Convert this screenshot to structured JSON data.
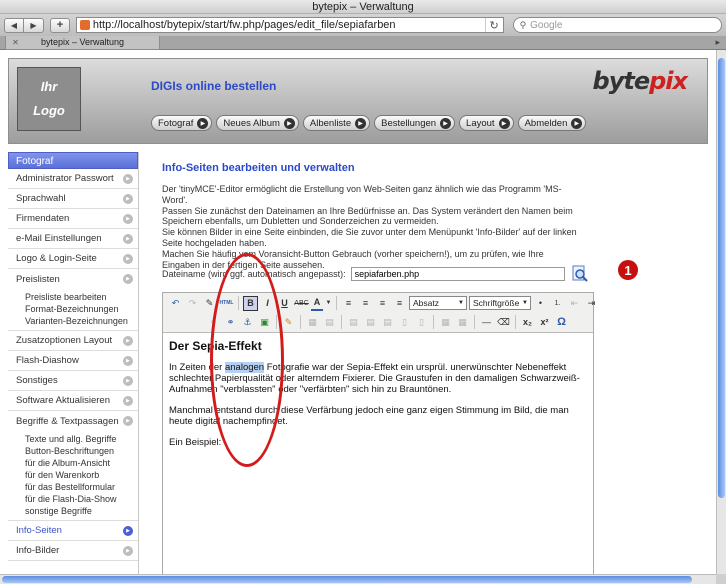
{
  "window": {
    "title": "bytepix – Verwaltung"
  },
  "browser": {
    "url": "http://localhost/bytepix/start/fw.php/pages/edit_file/sepiafarben",
    "search_placeholder": "Google",
    "tab_label": "bytepix – Verwaltung"
  },
  "header": {
    "logo_line1": "Ihr",
    "logo_line2": "Logo",
    "tagline": "DIGIs online bestellen",
    "brand_part1": "byte",
    "brand_part2": "pix",
    "nav": [
      "Fotograf",
      "Neues Album",
      "Albenliste",
      "Bestellungen",
      "Layout",
      "Abmelden"
    ]
  },
  "sidebar": {
    "heading": "Fotograf",
    "items": [
      {
        "label": "Administrator Passwort"
      },
      {
        "label": "Sprachwahl"
      },
      {
        "label": "Firmendaten"
      },
      {
        "label": "e-Mail Einstellungen"
      },
      {
        "label": "Logo & Login-Seite"
      },
      {
        "label": "Preislisten"
      }
    ],
    "preislisten_sub": [
      "Preisliste bearbeiten",
      "Format-Bezeichnungen",
      "Varianten-Bezeichnungen"
    ],
    "items2": [
      {
        "label": "Zusatzoptionen Layout"
      },
      {
        "label": "Flash-Diashow"
      },
      {
        "label": "Sonstiges"
      },
      {
        "label": "Software Aktualisieren"
      },
      {
        "label": "Begriffe & Textpassagen"
      }
    ],
    "begriffe_sub": [
      "Texte und allg. Begriffe",
      "Button-Beschriftungen",
      "für die Album-Ansicht",
      "für den Warenkorb",
      "für das Bestellformular",
      "für die Flash-Dia-Show",
      "sonstige Begriffe"
    ],
    "active_item": "Info-Seiten",
    "last_item": "Info-Bilder"
  },
  "main": {
    "title": "Info-Seiten bearbeiten und verwalten",
    "intro_lines": [
      "Der 'tinyMCE'-Editor ermöglicht die Erstellung von Web-Seiten ganz ähnlich wie das Programm 'MS-",
      "Word'.",
      "Passen Sie zunächst den Dateinamen an Ihre Bedürfnisse an. Das System verändert den Namen beim",
      "Speichern ebenfalls, um Dubletten und Sonderzeichen zu vermeiden.",
      "Sie können Bilder in eine Seite einbinden, die Sie zuvor unter dem Menüpunkt 'Info-Bilder' auf der linken",
      "Seite hochgeladen haben.",
      "Machen Sie häufig vom Voransicht-Button Gebrauch (vorher speichern!), um zu prüfen, wie Ihre",
      "Eingaben in der fertigen Seite aussehen."
    ],
    "filename_label": "Dateiname (wird ggf. automatisch angepasst):",
    "filename_value": "sepiafarben.php",
    "badge": "1"
  },
  "editor": {
    "format_select": "Absatz",
    "size_select": "Schriftgröße",
    "heading": "Der Sepia-Effekt",
    "p1_before": "In Zeiten der ",
    "p1_highlight": "analogen",
    "p1_after": " Fotografie war der Sepia-Effekt ein ursprül. unerwünschter Nebeneffekt schlechter Papierqualität oder alterndem Fixierer. Die Graustufen in den damaligen Schwarzweiß-Aufnahmen \"verblassten\" oder \"verfärbten\" sich hin zu Brauntönen.",
    "p2": "Manchmal entstand durch diese Verfärbung jedoch eine ganz eigen Stimmung im Bild, die man heute digital nachempfindet.",
    "p3": "Ein Beispiel:"
  },
  "colors": {
    "accent": "#2b49c8",
    "annotation": "#d31b1b",
    "sidebar_head": "#5c6fd8"
  }
}
